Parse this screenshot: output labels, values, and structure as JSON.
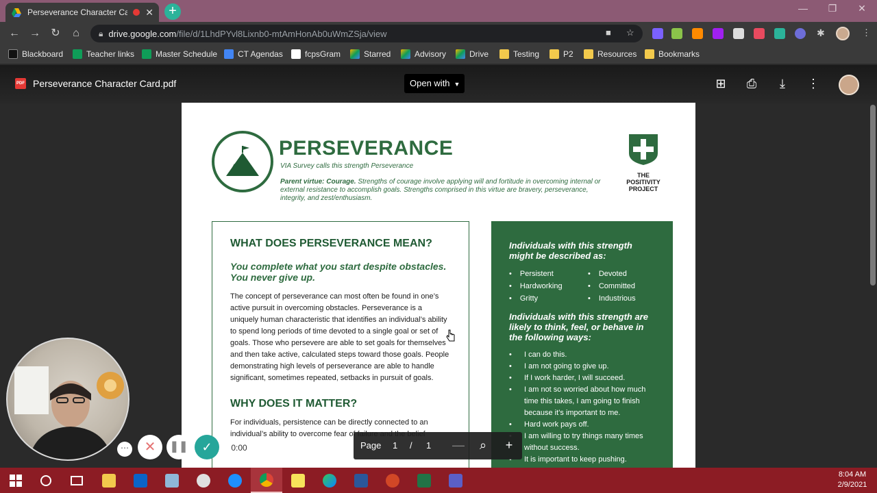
{
  "browser": {
    "tab_title": "Perseverance Character Card",
    "url_domain": "drive.google.com",
    "url_path": "/file/d/1LhdPYvl8Lixnb0-mtAmHonAb0uWmZSja/view"
  },
  "bookmarks": [
    {
      "label": "Blackboard",
      "icon": "blackboard-icon",
      "color": "#222222"
    },
    {
      "label": "Teacher links",
      "icon": "sheets-icon",
      "color": "#0f9d58"
    },
    {
      "label": "Master Schedule",
      "icon": "sheets-icon",
      "color": "#0f9d58"
    },
    {
      "label": "CT Agendas",
      "icon": "docs-icon",
      "color": "#4285f4"
    },
    {
      "label": "fcpsGram",
      "icon": "fcpsgram-icon",
      "color": "#ffffff"
    },
    {
      "label": "Starred",
      "icon": "drive-icon",
      "color": "#f4b400"
    },
    {
      "label": "Advisory",
      "icon": "drive-icon",
      "color": "#f4b400"
    },
    {
      "label": "Drive",
      "icon": "drive-icon",
      "color": "#f4b400"
    },
    {
      "label": "Testing",
      "icon": "folder-icon",
      "color": "#f2c94c"
    },
    {
      "label": "P2",
      "icon": "folder-icon",
      "color": "#f2c94c"
    },
    {
      "label": "Resources",
      "icon": "folder-icon",
      "color": "#f2c94c"
    },
    {
      "label": "Bookmarks",
      "icon": "folder-icon",
      "color": "#f2c94c"
    }
  ],
  "viewer": {
    "file_name": "Perseverance Character Card.pdf",
    "pdf_badge": "PDF",
    "open_with": "Open with"
  },
  "document": {
    "title": "PERSEVERANCE",
    "subtitle": "VIA Survey calls this strength Perseverance",
    "parent_virtue_label": "Parent virtue: Courage.",
    "parent_virtue_text": " Strengths of courage involve applying will and fortitude in overcoming internal or external resistance to accomplish goals. Strengths comprised in this virtue are bravery, perseverance, integrity, and zest/enthusiasm.",
    "logo_text_1": "THE",
    "logo_text_2": "POSITIVITY",
    "logo_text_3": "PROJECT",
    "left": {
      "heading": "WHAT DOES PERSEVERANCE MEAN?",
      "tagline": "You complete what you start despite obstacles. You never give up.",
      "body": "The concept of perseverance can most often be found in one’s active pursuit in overcoming obstacles. Perseverance is a uniquely human characteristic that identifies an individual’s ability to spend long periods of time devoted to a single goal or set of goals. Those who persevere are able to set goals for themselves and then take active, calculated steps toward those goals. People demonstrating high levels of perseverance are able to handle significant, sometimes repeated, setbacks in pursuit of goals.",
      "heading2": "WHY DOES IT MATTER?",
      "body2": "For individuals, persistence can be directly connected to an individual’s ability to overcome fear of failure and the belief"
    },
    "right": {
      "heading1": "Individuals with this strength might be described as:",
      "traits_col1": [
        "Persistent",
        "Hardworking",
        "Gritty"
      ],
      "traits_col2": [
        "Devoted",
        "Committed",
        "Industrious"
      ],
      "heading2": "Individuals with this strength are likely to think, feel, or behave in the following ways:",
      "behaviors": [
        "I can do this.",
        "I am not going to give up.",
        "If I work harder, I will succeed.",
        "I am not so worried about how much time this takes, I am going to finish because it’s important to me.",
        "Hard work pays off.",
        "I am willing to try things many times without success.",
        "It is important to keep pushing."
      ]
    }
  },
  "pdf_toolbar": {
    "page_label": "Page",
    "current_page": "1",
    "separator": "/",
    "total_pages": "1"
  },
  "recorder": {
    "time": "0:00"
  },
  "taskbar": {
    "time": "8:04 AM",
    "date": "2/9/2021",
    "apps": [
      "start-icon",
      "search-icon",
      "task-view-icon",
      "file-explorer-icon",
      "outlook-icon",
      "sis-icon",
      "paint-icon",
      "internet-explorer-icon",
      "chrome-icon",
      "sticky-notes-icon",
      "edge-icon",
      "word-icon",
      "powerpoint-icon",
      "excel-icon",
      "teams-icon"
    ]
  },
  "colors": {
    "accent_green": "#2e6b3f",
    "chrome_frame": "#8c5a74",
    "taskbar": "#8c1c24"
  }
}
